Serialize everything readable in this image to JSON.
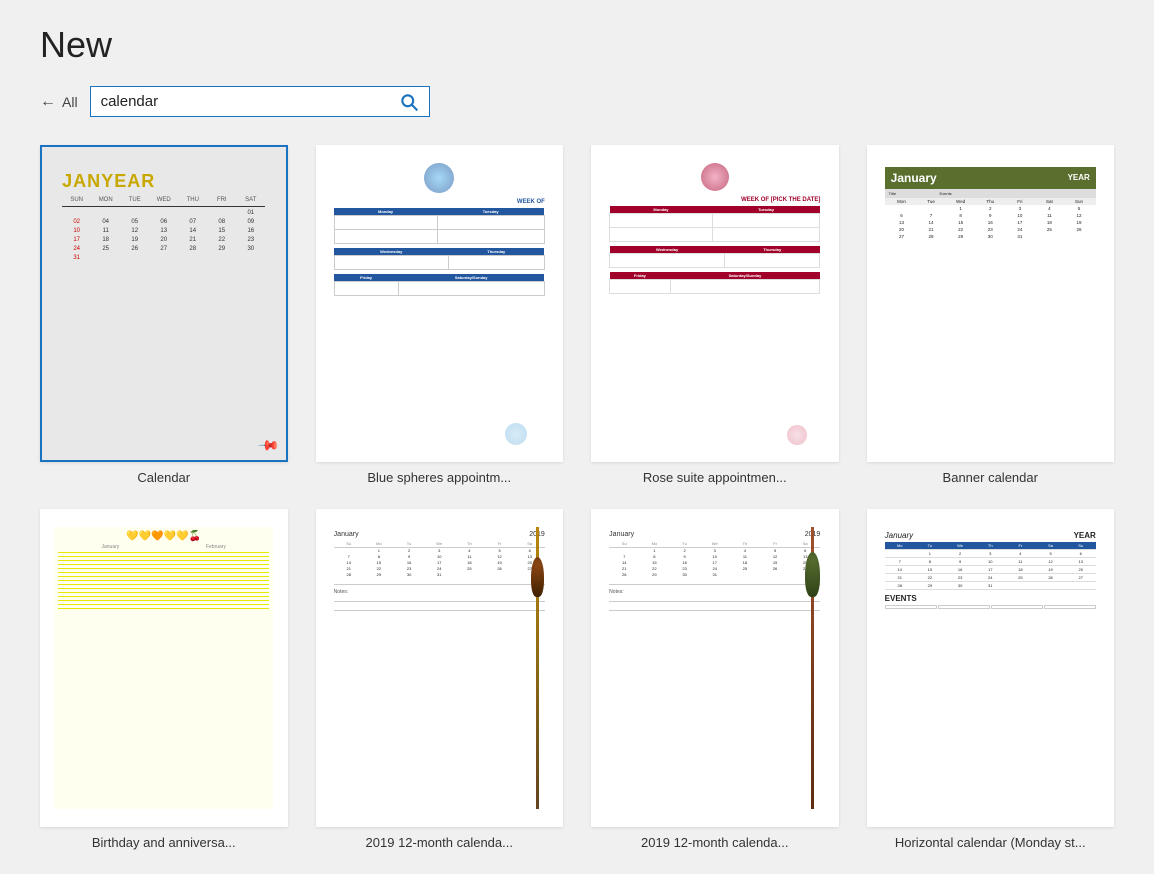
{
  "page": {
    "title": "New"
  },
  "search": {
    "back_label": "All",
    "placeholder": "calendar",
    "value": "calendar",
    "button_label": "Search"
  },
  "templates": [
    {
      "id": "calendar",
      "label": "Calendar",
      "selected": true,
      "type": "basic-calendar"
    },
    {
      "id": "blue-spheres",
      "label": "Blue spheres appointm...",
      "selected": false,
      "type": "blue-spheres"
    },
    {
      "id": "rose-suite",
      "label": "Rose suite appointmen...",
      "selected": false,
      "type": "rose-suite"
    },
    {
      "id": "banner-calendar",
      "label": "Banner calendar",
      "selected": false,
      "type": "banner"
    },
    {
      "id": "birthday-anniversary",
      "label": "Birthday and anniversa...",
      "selected": false,
      "type": "birthday"
    },
    {
      "id": "2019-12month-a",
      "label": "2019 12-month calenda...",
      "selected": false,
      "type": "2019a"
    },
    {
      "id": "2019-12month-b",
      "label": "2019 12-month calenda...",
      "selected": false,
      "type": "2019b"
    },
    {
      "id": "horizontal-calendar",
      "label": "Horizontal calendar (Monday st...",
      "selected": false,
      "type": "horizontal"
    }
  ]
}
